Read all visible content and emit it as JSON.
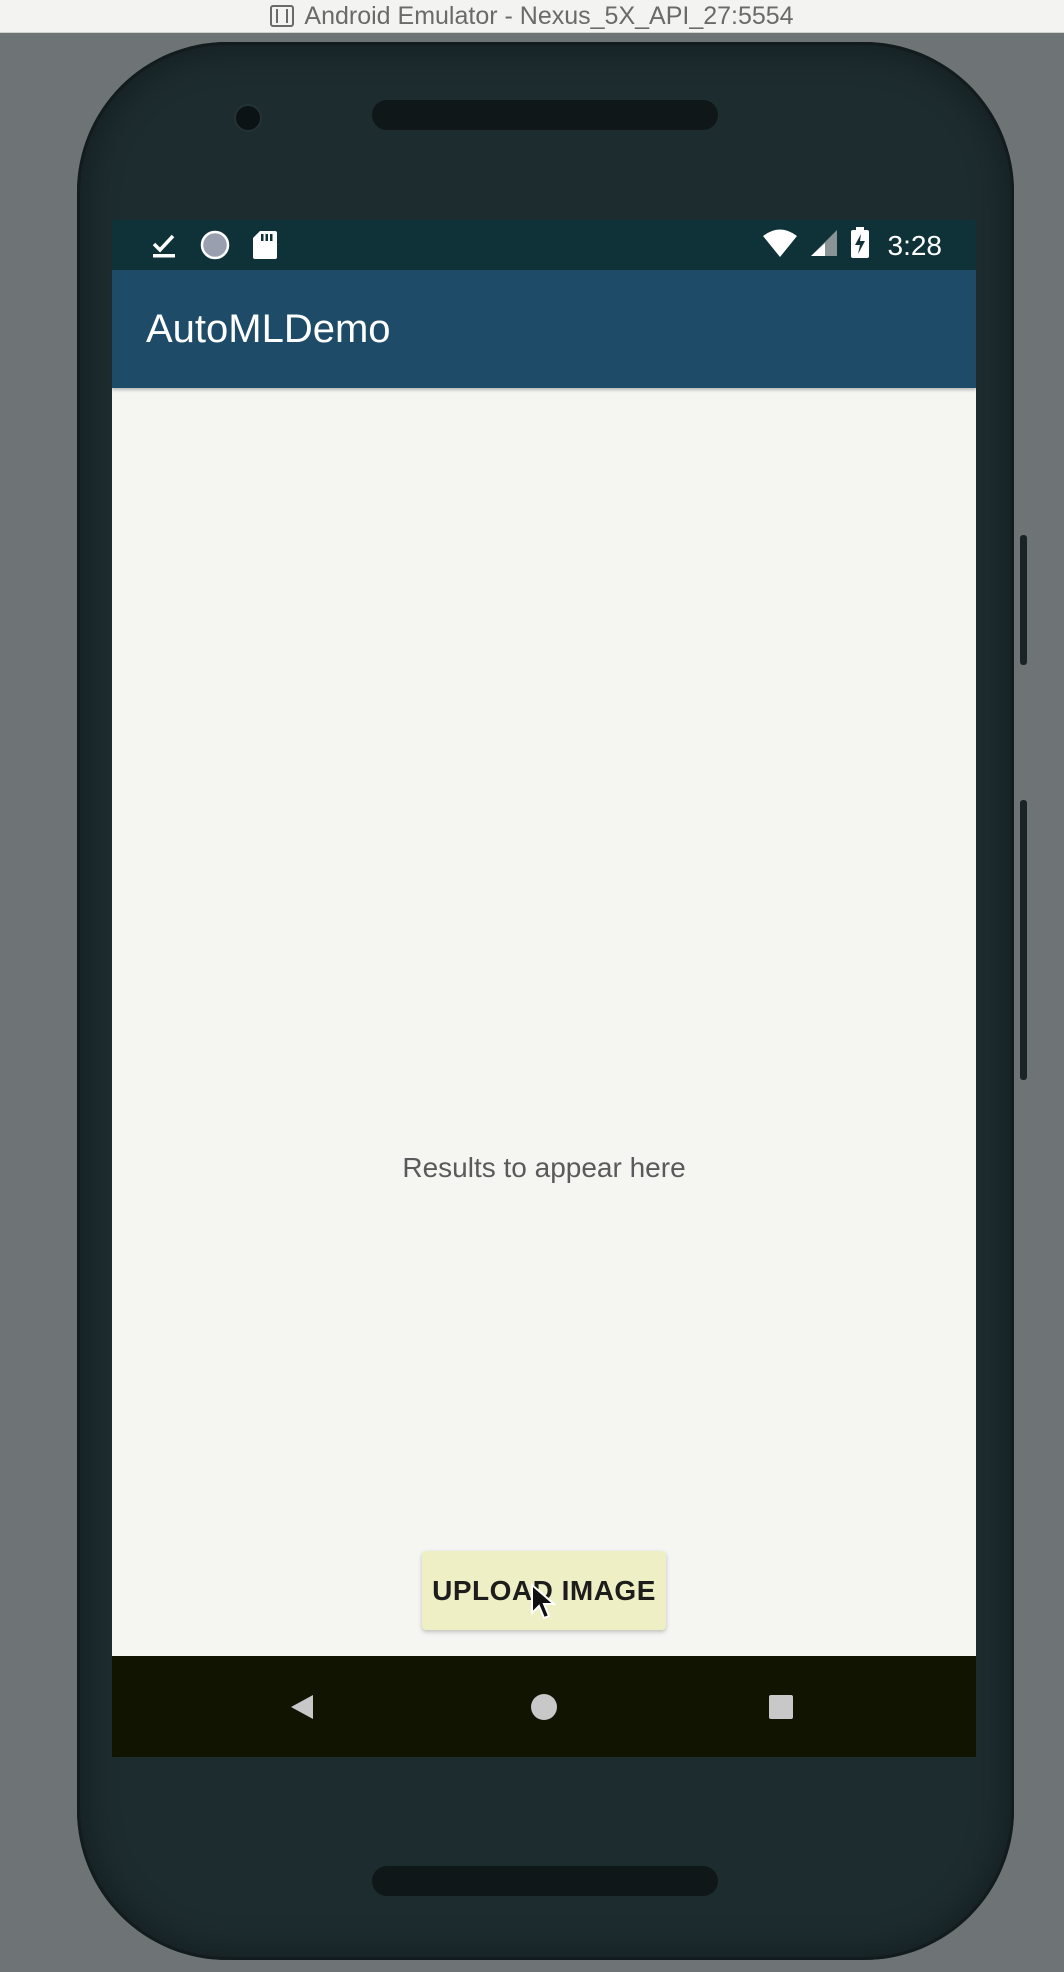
{
  "window": {
    "title": "Android Emulator - Nexus_5X_API_27:5554",
    "icon": "emulator-icon"
  },
  "status_bar": {
    "time": "3:28",
    "left_icons": [
      "download-complete-icon",
      "circle-notification-icon",
      "sd-card-icon"
    ],
    "right_icons": [
      "wifi-icon",
      "cell-signal-icon",
      "battery-charging-icon"
    ]
  },
  "app_bar": {
    "title": "AutoMLDemo"
  },
  "main": {
    "results_text": "Results to appear here",
    "upload_button_label": "UPLOAD IMAGE"
  },
  "nav_bar": {
    "buttons": [
      "back-icon",
      "home-icon",
      "recents-icon"
    ]
  },
  "colors": {
    "status_bar": "#0f3238",
    "app_bar": "#1e4b68",
    "screen_background": "#f5f5f2",
    "button_background": "#efefc6",
    "nav_bar": "#111400",
    "device_body": "#1d2c2f"
  }
}
